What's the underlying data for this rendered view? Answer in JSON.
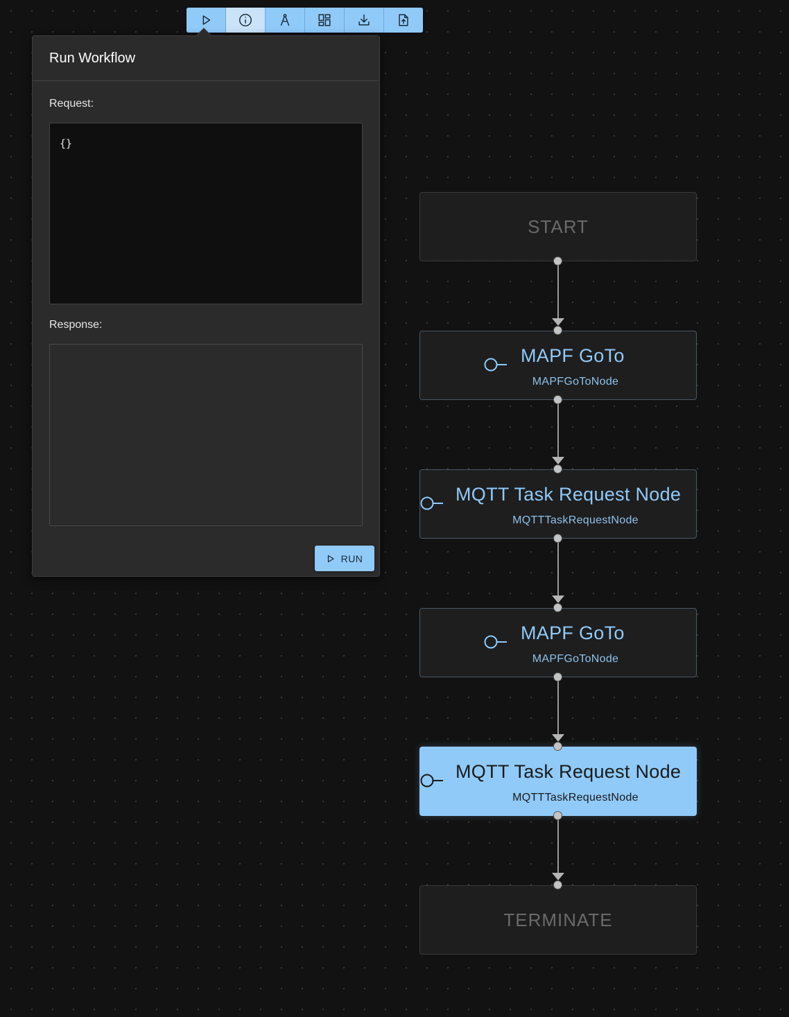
{
  "toolbar": {
    "buttons": [
      {
        "name": "play-icon",
        "title": "Run"
      },
      {
        "name": "info-icon",
        "title": "Info"
      },
      {
        "name": "compass-icon",
        "title": "Layout"
      },
      {
        "name": "dashboard-icon",
        "title": "Arrange"
      },
      {
        "name": "download-icon",
        "title": "Download"
      },
      {
        "name": "upload-file-icon",
        "title": "Upload"
      }
    ],
    "active_index": 1
  },
  "run_panel": {
    "title": "Run Workflow",
    "request_label": "Request:",
    "request_value": "{}",
    "response_label": "Response:",
    "response_value": "",
    "run_label": "RUN"
  },
  "workflow": {
    "start_label": "START",
    "terminate_label": "TERMINATE",
    "nodes": [
      {
        "title": "MAPF GoTo",
        "type": "MAPFGoToNode",
        "selected": false
      },
      {
        "title": "MQTT Task Request Node",
        "type": "MQTTTaskRequestNode",
        "selected": false
      },
      {
        "title": "MAPF GoTo",
        "type": "MAPFGoToNode",
        "selected": false
      },
      {
        "title": "MQTT Task Request Node",
        "type": "MQTTTaskRequestNode",
        "selected": true
      }
    ]
  },
  "colors": {
    "accent": "#90caf9",
    "background": "#121212",
    "panel": "#2b2b2b"
  }
}
